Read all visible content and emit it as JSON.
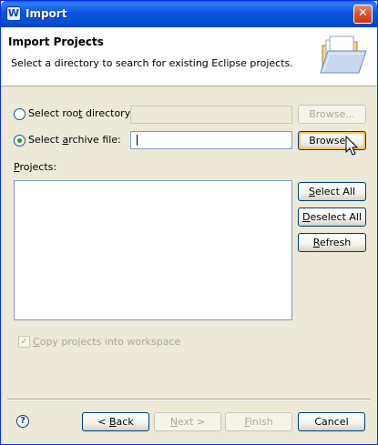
{
  "window": {
    "title": "Import",
    "icon": "app-w-icon",
    "close_label": "✕"
  },
  "header": {
    "title": "Import Projects",
    "description": "Select a directory to search for existing Eclipse projects.",
    "icon": "folder-icon"
  },
  "source": {
    "root_directory": {
      "prefix": "Select roo",
      "mnemonic": "t",
      "suffix": " directory:",
      "selected": false,
      "value": "",
      "browse_label": "Browse..."
    },
    "archive_file": {
      "prefix": "Select ",
      "mnemonic": "a",
      "suffix": "rchive file:",
      "selected": true,
      "value": "",
      "browse_label": "Browse..."
    }
  },
  "projects": {
    "label_mnemonic": "P",
    "label_rest": "rojects:",
    "items": [],
    "select_all": {
      "mnemonic": "S",
      "rest": "elect All"
    },
    "deselect_all": {
      "mnemonic": "D",
      "rest": "eselect All"
    },
    "refresh": {
      "mnemonic": "R",
      "rest": "efresh"
    }
  },
  "copy_into_workspace": {
    "mnemonic": "C",
    "rest": "opy projects into workspace",
    "checked": true,
    "enabled": false
  },
  "footer": {
    "help": "?",
    "back": {
      "prefix": "< ",
      "mnemonic": "B",
      "rest": "ack"
    },
    "next": {
      "prefix": "",
      "mnemonic": "N",
      "rest": "ext >"
    },
    "finish": {
      "prefix": "",
      "mnemonic": "F",
      "rest": "inish"
    },
    "cancel": "Cancel"
  },
  "colors": {
    "titlebar": "#0550d6",
    "dialog_bg": "#ece9d8",
    "radio_dot": "#21a121",
    "button_border": "#003c74",
    "disabled_text": "#aca899"
  }
}
